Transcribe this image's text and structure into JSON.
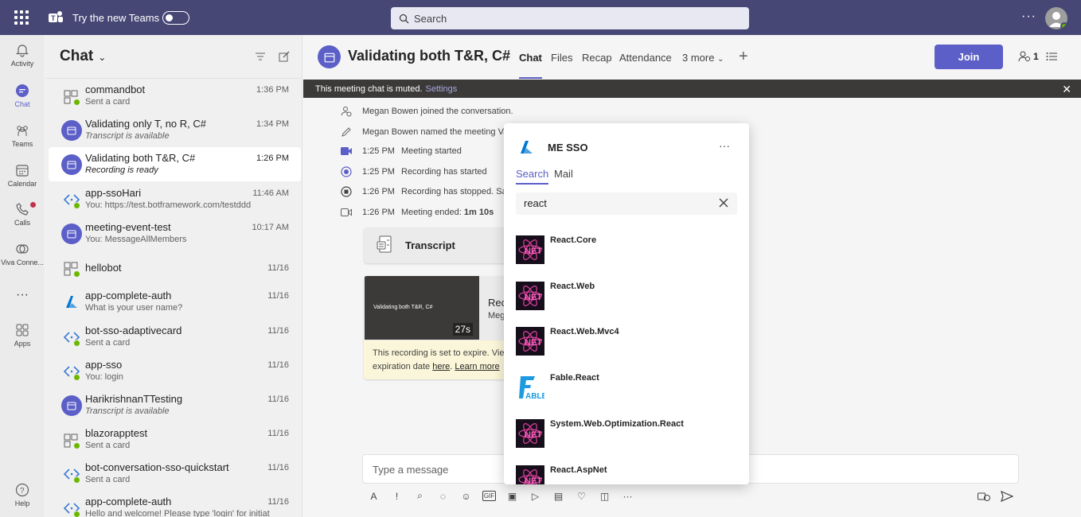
{
  "topbar": {
    "try_label": "Try the new Teams",
    "search_placeholder": "Search"
  },
  "rail": [
    {
      "label": "Activity",
      "icon": "bell-icon"
    },
    {
      "label": "Chat",
      "icon": "chat-icon"
    },
    {
      "label": "Teams",
      "icon": "teams-icon"
    },
    {
      "label": "Calendar",
      "icon": "calendar-icon"
    },
    {
      "label": "Calls",
      "icon": "phone-icon"
    },
    {
      "label": "Viva Conne...",
      "icon": "viva-icon"
    },
    {
      "label": "Apps",
      "icon": "apps-icon"
    },
    {
      "label": "Help",
      "icon": "help-icon"
    }
  ],
  "chatlist": {
    "title": "Chat",
    "items": [
      {
        "name": "commandbot",
        "sub": "Sent a card",
        "time": "1:36 PM"
      },
      {
        "name": "Validating only T, no R, C#",
        "sub": "Transcript is available",
        "time": "1:34 PM"
      },
      {
        "name": "Validating both T&R, C#",
        "sub": "Recording is ready",
        "time": "1:26 PM"
      },
      {
        "name": "app-ssoHari",
        "sub": "You: https://test.botframework.com/testddd",
        "time": "11:46 AM"
      },
      {
        "name": "meeting-event-test",
        "sub": "You: MessageAllMembers",
        "time": "10:17 AM"
      },
      {
        "name": "hellobot",
        "sub": "",
        "time": "11/16"
      },
      {
        "name": "app-complete-auth",
        "sub": "What is your user name?",
        "time": "11/16"
      },
      {
        "name": "bot-sso-adaptivecard",
        "sub": "Sent a card",
        "time": "11/16"
      },
      {
        "name": "app-sso",
        "sub": "You: login",
        "time": "11/16"
      },
      {
        "name": "HarikrishnanTTesting",
        "sub": "Transcript is available",
        "time": "11/16"
      },
      {
        "name": "blazorapptest",
        "sub": "Sent a card",
        "time": "11/16"
      },
      {
        "name": "bot-conversation-sso-quickstart",
        "sub": "Sent a card",
        "time": "11/16"
      },
      {
        "name": "app-complete-auth",
        "sub": "Hello and welcome! Please type 'login' for initiat",
        "time": "11/16"
      }
    ]
  },
  "meeting": {
    "title": "Validating both T&R, C#",
    "tabs": [
      "Chat",
      "Files",
      "Recap",
      "Attendance",
      "3 more"
    ],
    "join_label": "Join",
    "participants": "1",
    "banner_text": "This meeting chat is muted.",
    "banner_link": "Settings",
    "events": [
      {
        "time": "",
        "text": "Megan Bowen joined the conversation."
      },
      {
        "time": "",
        "text": "Megan Bowen named the meeting Va"
      },
      {
        "time": "1:25 PM",
        "text": "Meeting started"
      },
      {
        "time": "1:25 PM",
        "text": "Recording has started"
      },
      {
        "time": "1:26 PM",
        "text": "Recording has stopped. Sa"
      },
      {
        "time": "1:26 PM",
        "text": "Meeting ended:",
        "bold": "1m 10s"
      }
    ],
    "transcript_label": "Transcript",
    "recording": {
      "thumb_title": "Validating both T&R, C#",
      "duration": "27s",
      "title": "Rec",
      "sub": "Meg",
      "warning_a": "This recording is set to expire. View",
      "warning_b": "expiration date",
      "warning_link1": "here",
      "warning_link2": "Learn more"
    },
    "composer_placeholder": "Type a message"
  },
  "popup": {
    "title": "ME SSO",
    "tabs": [
      "Search",
      "Mail"
    ],
    "query": "react",
    "results": [
      {
        "name": "React.Core",
        "logo": "net"
      },
      {
        "name": "React.Web",
        "logo": "net"
      },
      {
        "name": "React.Web.Mvc4",
        "logo": "net"
      },
      {
        "name": "Fable.React",
        "logo": "fable"
      },
      {
        "name": "System.Web.Optimization.React",
        "logo": "net"
      },
      {
        "name": "React.AspNet",
        "logo": "net"
      }
    ]
  },
  "colors": {
    "brand": "#464775",
    "accent": "#5b5fc7",
    "online": "#6bb700"
  }
}
